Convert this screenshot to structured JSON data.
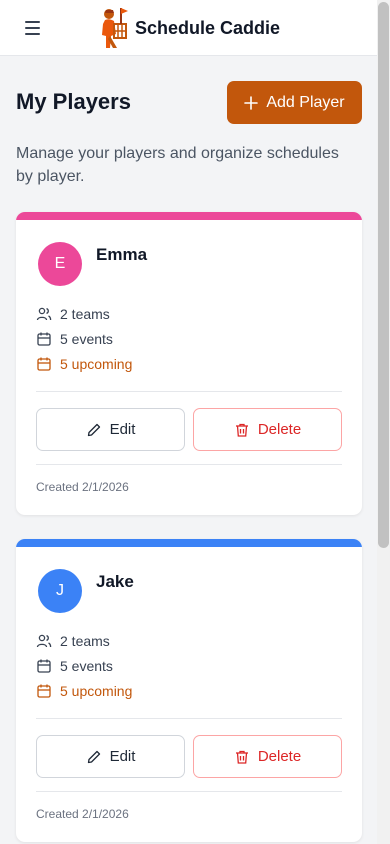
{
  "app": {
    "title": "Schedule Caddie"
  },
  "page": {
    "title": "My Players",
    "subtitle": "Manage your players and organize schedules by player.",
    "add_button_label": "Add Player"
  },
  "players": [
    {
      "initial": "E",
      "name": "Emma",
      "color": "#ec4899",
      "teams": "2 teams",
      "events": "5 events",
      "upcoming": "5 upcoming",
      "edit_label": "Edit",
      "delete_label": "Delete",
      "created": "Created 2/1/2026"
    },
    {
      "initial": "J",
      "name": "Jake",
      "color": "#3b82f6",
      "teams": "2 teams",
      "events": "5 events",
      "upcoming": "5 upcoming",
      "edit_label": "Edit",
      "delete_label": "Delete",
      "created": "Created 2/1/2026"
    }
  ],
  "icons": {
    "menu": "hamburger-menu-icon",
    "logo": "caddie-logo",
    "add": "plus-icon",
    "teams": "users-icon",
    "events": "calendar-icon",
    "upcoming": "calendar-icon",
    "edit": "pencil-icon",
    "delete": "trash-icon"
  },
  "colors": {
    "accent": "#c2570c",
    "danger": "#dc2626"
  }
}
